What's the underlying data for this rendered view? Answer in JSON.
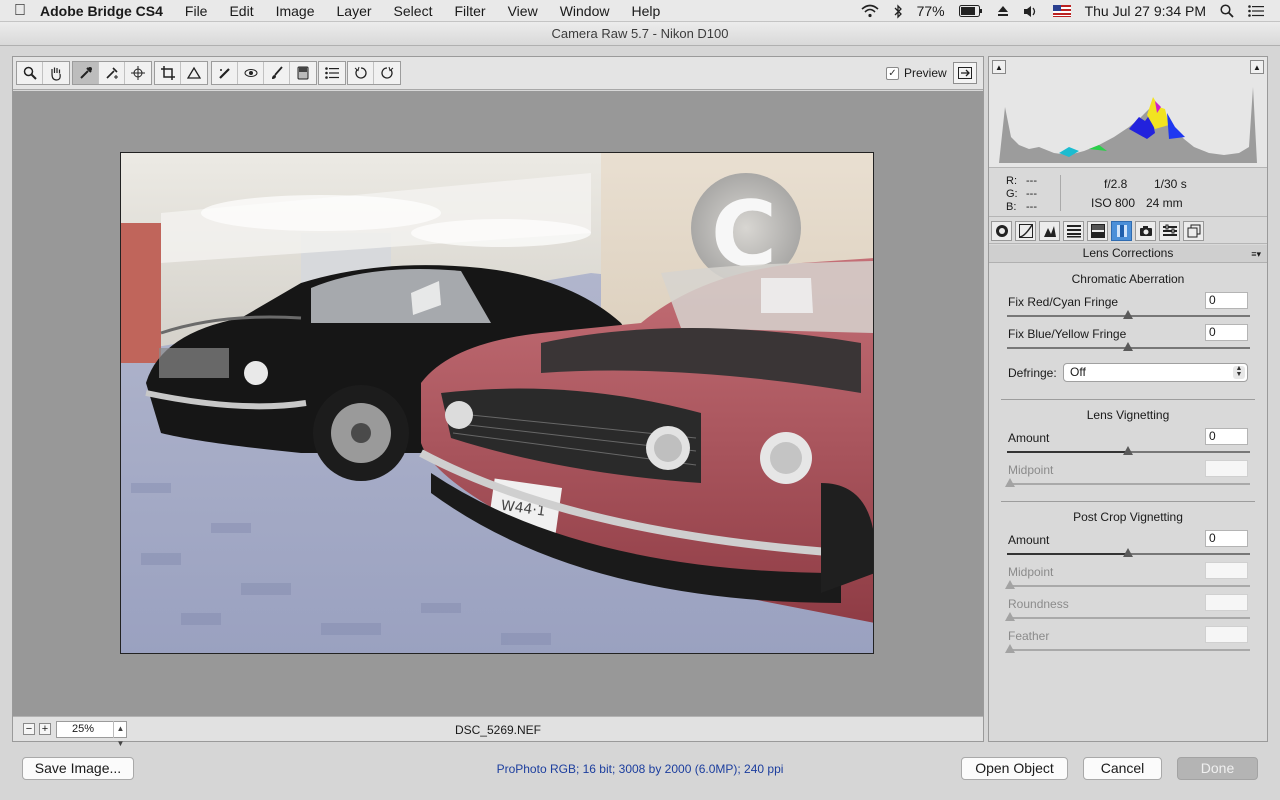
{
  "menubar": {
    "app_name": "Adobe Bridge CS4",
    "menus": [
      "File",
      "Edit",
      "Image",
      "Layer",
      "Select",
      "Filter",
      "View",
      "Window",
      "Help"
    ],
    "battery": "77%",
    "datetime": "Thu Jul 27  9:34 PM",
    "icons": [
      "apple-icon",
      "wifi-icon",
      "bluetooth-icon",
      "battery-icon",
      "eject-icon",
      "volume-icon",
      "flag-icon",
      "spotlight-icon",
      "notification-icon"
    ]
  },
  "window": {
    "title": "Camera Raw 5.7  -  Nikon D100"
  },
  "toolbar": {
    "tools": [
      "zoom-tool-icon",
      "hand-tool-icon",
      "white-balance-tool-icon",
      "color-sampler-tool-icon",
      "targeted-adjustment-tool-icon",
      "crop-tool-icon",
      "straighten-tool-icon",
      "spot-removal-tool-icon",
      "red-eye-tool-icon",
      "adjustment-brush-icon",
      "graduated-filter-icon",
      "preferences-icon",
      "rotate-left-icon",
      "rotate-right-icon"
    ],
    "active_tool": "white-balance-tool-icon",
    "preview_label": "Preview",
    "preview_checked": true
  },
  "image": {
    "zoom": "25%",
    "filename": "DSC_5269.NEF"
  },
  "histogram": {
    "rgb_labels": {
      "r": "R:",
      "g": "G:",
      "b": "B:"
    },
    "rgb_values": {
      "r": "---",
      "g": "---",
      "b": "---"
    },
    "aperture": "f/2.8",
    "shutter": "1/30 s",
    "iso": "ISO 800",
    "focal": "24 mm"
  },
  "panel": {
    "tabs": [
      "basic-icon",
      "tone-curve-icon",
      "detail-icon",
      "hsl-icon",
      "split-toning-icon",
      "lens-corrections-icon",
      "camera-calibration-icon",
      "presets-icon",
      "snapshots-icon"
    ],
    "active_tab": "lens-corrections-icon",
    "title": "Lens Corrections",
    "chromatic": {
      "title": "Chromatic Aberration",
      "red_cyan_label": "Fix Red/Cyan Fringe",
      "red_cyan_value": "0",
      "blue_yellow_label": "Fix Blue/Yellow Fringe",
      "blue_yellow_value": "0",
      "defringe_label": "Defringe:",
      "defringe_value": "Off"
    },
    "lens_vignetting": {
      "title": "Lens Vignetting",
      "amount_label": "Amount",
      "amount_value": "0",
      "midpoint_label": "Midpoint",
      "midpoint_value": ""
    },
    "post_crop": {
      "title": "Post Crop Vignetting",
      "amount_label": "Amount",
      "amount_value": "0",
      "midpoint_label": "Midpoint",
      "roundness_label": "Roundness",
      "feather_label": "Feather"
    }
  },
  "footer": {
    "save_label": "Save Image...",
    "workflow": "ProPhoto RGB; 16 bit; 3008 by 2000 (6.0MP); 240 ppi",
    "open_label": "Open Object",
    "cancel_label": "Cancel",
    "done_label": "Done"
  }
}
